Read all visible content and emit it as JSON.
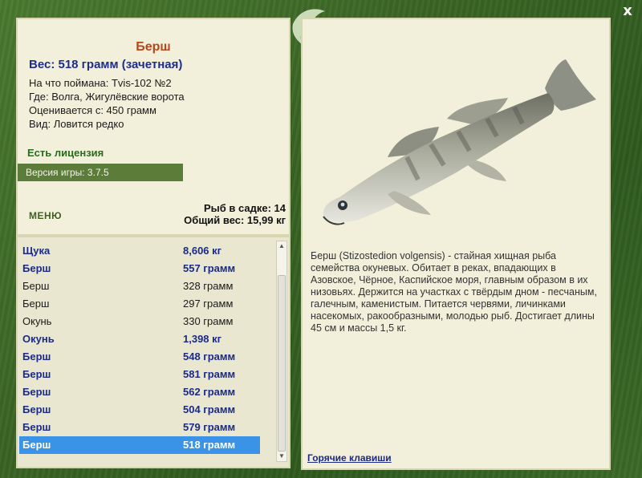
{
  "close_label": "x",
  "fish": {
    "name": "Берш",
    "weight": "Вес: 518 грамм (зачетная)",
    "bait": "На что поймана: Tvis-102 №2",
    "place": "Где: Волга, Жигулёвские ворота",
    "min_weight": "Оценивается с: 450 грамм",
    "rarity": "Вид: Ловится редко"
  },
  "license": "Есть лицензия",
  "version": "Версия игры: 3.7.5",
  "menu_label": "МЕНЮ",
  "stats": {
    "count": "Рыб в садке: 14",
    "total": "Общий вес: 15,99 кг"
  },
  "catch_list": [
    {
      "name": "Щука",
      "weight": "8,606 кг",
      "style": "bold"
    },
    {
      "name": "Берш",
      "weight": "557 грамм",
      "style": "bold"
    },
    {
      "name": "Берш",
      "weight": "328 грамм",
      "style": "plain"
    },
    {
      "name": "Берш",
      "weight": "297 грамм",
      "style": "plain"
    },
    {
      "name": "Окунь",
      "weight": "330 грамм",
      "style": "plain"
    },
    {
      "name": "Окунь",
      "weight": "1,398 кг",
      "style": "bold"
    },
    {
      "name": "Берш",
      "weight": "548 грамм",
      "style": "bold"
    },
    {
      "name": "Берш",
      "weight": "581 грамм",
      "style": "bold"
    },
    {
      "name": "Берш",
      "weight": "562 грамм",
      "style": "bold"
    },
    {
      "name": "Берш",
      "weight": "504 грамм",
      "style": "bold"
    },
    {
      "name": "Берш",
      "weight": "579 грамм",
      "style": "bold"
    },
    {
      "name": "Берш",
      "weight": "518 грамм",
      "style": "sel"
    }
  ],
  "description": "Берш (Stizostedion volgensis) - стайная хищная рыба семейства окуневых. Обитает в реках, впадающих в Азовское, Чёрное, Каспийское моря, главным образом в их низовьях. Держится на участках с твёрдым дном - песчаным, галечным, каменистым. Питается червями, личинками насекомых, ракообразными, молодью рыб. Достигает длины 45 см и массы 1,5 кг.",
  "hotkeys_label": "Горячие клавиши",
  "colors": {
    "frame": "#3f6b2a",
    "panel": "#f2f0db",
    "title": "#b8461c",
    "link": "#1b2a88",
    "selection": "#3a93e6",
    "license": "#2a6a1c"
  },
  "icons": {
    "logo": "fish-logo-icon",
    "close": "close-icon",
    "fish_image": "zander-fish-image"
  }
}
